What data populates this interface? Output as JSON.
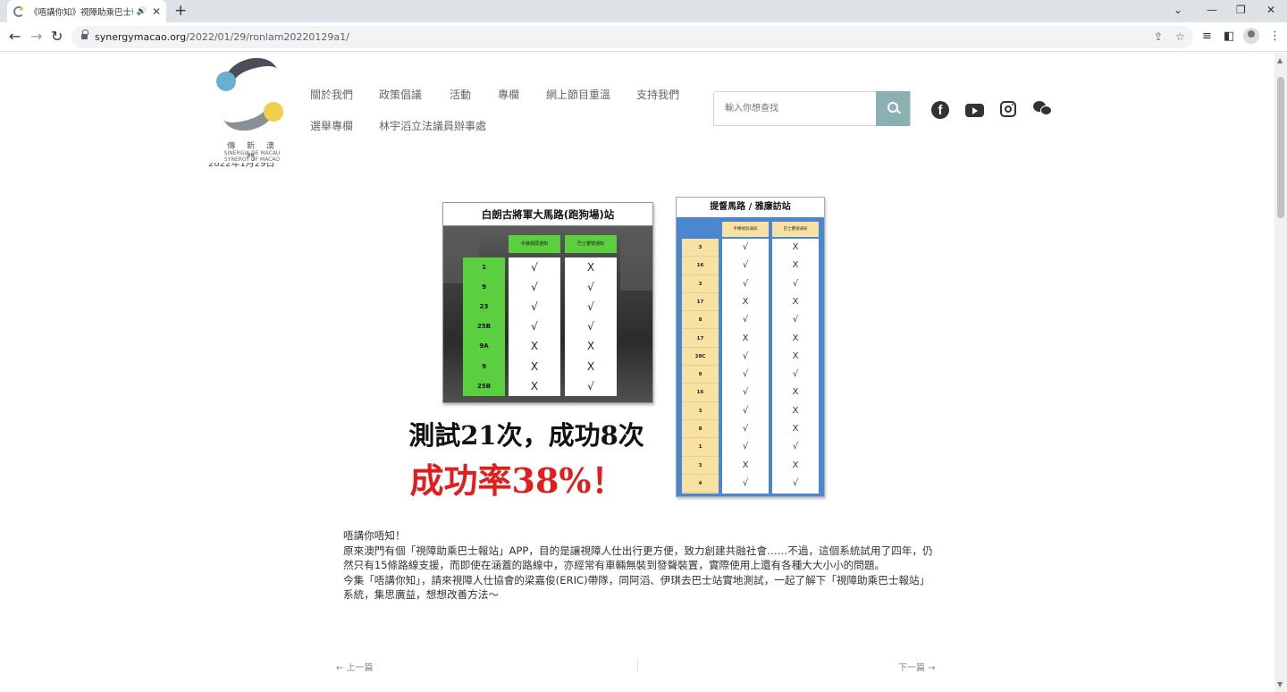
{
  "browser": {
    "tab_title": "《唔講你知》視障助乘巴士報",
    "url_host": "synergymacao.org",
    "url_path": "/2022/01/29/ronlam20220129a1/"
  },
  "site": {
    "logo_name": "傳 新 澳 門",
    "logo_sub1": "SINERGIA DE MACAU",
    "logo_sub2": "SYNERGY OF MACAO",
    "date_fragment": "2022年1月29日",
    "menu": [
      "關於我們",
      "政策倡議",
      "活動",
      "專欄",
      "網上節目重溫",
      "支持我們",
      "選舉專欄",
      "林宇滔立法議員辦事處"
    ],
    "search_placeholder": "輸入你想查找",
    "social": [
      "facebook-icon",
      "youtube-icon",
      "instagram-icon",
      "wechat-icon"
    ],
    "colors": {
      "search_button": "#8bb0b2",
      "green": "#5ad03f",
      "blue": "#4a87d0",
      "yellow": "#f8e2a3",
      "red": "#e31d1d"
    }
  },
  "panel1": {
    "title": "白朗古將軍大馬路(跑狗場)站",
    "col1_header": "手機視屏通知",
    "col2_header": "巴士響號通知",
    "rows": [
      {
        "route": "1",
        "a": "√",
        "b": "X"
      },
      {
        "route": "9",
        "a": "√",
        "b": "√"
      },
      {
        "route": "23",
        "a": "√",
        "b": "√"
      },
      {
        "route": "25B",
        "a": "√",
        "b": "√"
      },
      {
        "route": "9A",
        "a": "X",
        "b": "X"
      },
      {
        "route": "9",
        "a": "X",
        "b": "X"
      },
      {
        "route": "25B",
        "a": "X",
        "b": "√"
      }
    ]
  },
  "panel2": {
    "title": "提督馬路 / 雅廉訪站",
    "col1_header": "手機視屏通知",
    "col2_header": "巴士響號通知",
    "rows": [
      {
        "route": "3",
        "a": "√",
        "b": "X"
      },
      {
        "route": "16",
        "a": "√",
        "b": "X"
      },
      {
        "route": "3",
        "a": "√",
        "b": "√"
      },
      {
        "route": "17",
        "a": "X",
        "b": "X"
      },
      {
        "route": "8",
        "a": "√",
        "b": "√"
      },
      {
        "route": "17",
        "a": "X",
        "b": "X"
      },
      {
        "route": "28C",
        "a": "√",
        "b": "X"
      },
      {
        "route": "9",
        "a": "√",
        "b": "√"
      },
      {
        "route": "16",
        "a": "√",
        "b": "X"
      },
      {
        "route": "3",
        "a": "√",
        "b": "X"
      },
      {
        "route": "8",
        "a": "√",
        "b": "X"
      },
      {
        "route": "1",
        "a": "√",
        "b": "√"
      },
      {
        "route": "3",
        "a": "X",
        "b": "X"
      },
      {
        "route": "4",
        "a": "√",
        "b": "√"
      }
    ]
  },
  "stats": {
    "line1": "測試21次，成功8次",
    "line2": "成功率38%！"
  },
  "article": {
    "p1": "唔講你唔知！",
    "p2": "原來澳門有個「視障助乘巴士報站」APP，目的是讓視障人仕出行更方便，致力創建共融社會……不過，這個系統試用了四年，仍然只有15條路線支援，而即使在涵蓋的路線中，亦經常有車輛無裝到發聲裝置，實際使用上還有各種大大小小的問題。",
    "p3": "今集「唔講你知」，請來視障人仕協會的梁嘉俊(ERIC)帶隊，同阿滔、伊琪去巴士站實地測試，一起了解下「視障助乘巴士報站」系統，集思廣益，想想改善方法～"
  },
  "post_nav": {
    "prev": "← 上一篇",
    "next": "下一篇 →"
  }
}
